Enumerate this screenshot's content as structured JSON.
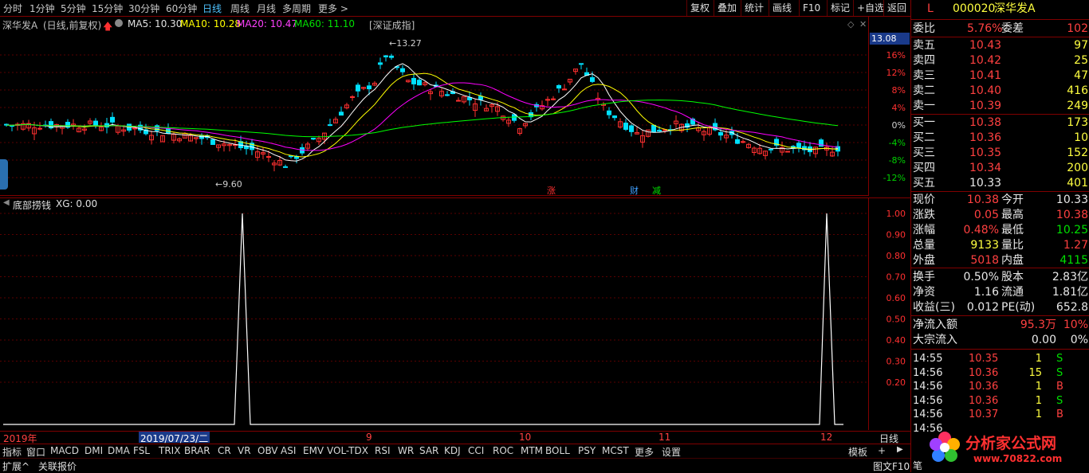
{
  "toolbar": {
    "periods": [
      "分时",
      "1分钟",
      "5分钟",
      "15分钟",
      "30分钟",
      "60分钟",
      "日线",
      "周线",
      "月线",
      "多周期",
      "更多 >"
    ],
    "active_period": "日线",
    "right_buttons": [
      "复权",
      "叠加",
      "统计",
      "画线",
      "F10",
      "标记",
      "+自选",
      "返回"
    ]
  },
  "chart_header": {
    "stock_name": "深华发A",
    "adjust": "(日线,前复权)",
    "ma5": "MA5: 10.30",
    "ma10": "MA10: 10.28",
    "ma20": "MA20: 10.47",
    "ma60": "MA60: 11.10",
    "index_tag": "[深证成指]",
    "high_label": "13.27",
    "low_label": "9.60",
    "price_tag": "13.08",
    "event_tags": [
      "涨",
      "财",
      "减"
    ]
  },
  "price_axis": [
    "16%",
    "12%",
    "8%",
    "4%",
    "0%",
    "-4%",
    "-8%",
    "-12%"
  ],
  "indicator": {
    "name": "底部捞钱",
    "value": "XG: 0.00",
    "axis": [
      "1.00",
      "0.90",
      "0.80",
      "0.70",
      "0.60",
      "0.50",
      "0.40",
      "0.30",
      "0.20"
    ]
  },
  "date_axis": {
    "year": "2019年",
    "cursor_date": "2019/07/23/二",
    "months": [
      "9",
      "10",
      "11",
      "12"
    ],
    "period_label": "日线"
  },
  "indicator_tabs": [
    "指标",
    "窗口",
    "MACD",
    "DMI",
    "DMA",
    "FSL",
    "TRIX",
    "BRAR",
    "CR",
    "VR",
    "OBV",
    "ASI",
    "EMV",
    "VOL-TDX",
    "RSI",
    "WR",
    "SAR",
    "KDJ",
    "CCI",
    "ROC",
    "MTM",
    "BOLL",
    "PSY",
    "MCST",
    "更多",
    "设置"
  ],
  "template_btn": "模板",
  "status": {
    "expand": "扩展^",
    "linked": "关联报价",
    "graphic": "图文F10",
    "note": "笔"
  },
  "quote": {
    "flag": "L",
    "code": "000020",
    "name": "深华发A",
    "weibi_label": "委比",
    "weibi": "5.76%",
    "weicha_label": "委差",
    "weicha": "102",
    "asks": [
      {
        "label": "卖五",
        "price": "10.43",
        "vol": "97"
      },
      {
        "label": "卖四",
        "price": "10.42",
        "vol": "25"
      },
      {
        "label": "卖三",
        "price": "10.41",
        "vol": "47"
      },
      {
        "label": "卖二",
        "price": "10.40",
        "vol": "416"
      },
      {
        "label": "卖一",
        "price": "10.39",
        "vol": "249"
      }
    ],
    "bids": [
      {
        "label": "买一",
        "price": "10.38",
        "vol": "173"
      },
      {
        "label": "买二",
        "price": "10.36",
        "vol": "10"
      },
      {
        "label": "买三",
        "price": "10.35",
        "vol": "152"
      },
      {
        "label": "买四",
        "price": "10.34",
        "vol": "200"
      },
      {
        "label": "买五",
        "price": "10.33",
        "vol": "401"
      }
    ],
    "stats": [
      {
        "l1": "现价",
        "v1": "10.38",
        "c1": "red",
        "l2": "今开",
        "v2": "10.33",
        "c2": "wht"
      },
      {
        "l1": "涨跌",
        "v1": "0.05",
        "c1": "red",
        "l2": "最高",
        "v2": "10.38",
        "c2": "red"
      },
      {
        "l1": "涨幅",
        "v1": "0.48%",
        "c1": "red",
        "l2": "最低",
        "v2": "10.25",
        "c2": "grn"
      },
      {
        "l1": "总量",
        "v1": "9133",
        "c1": "yel",
        "l2": "量比",
        "v2": "1.27",
        "c2": "red"
      },
      {
        "l1": "外盘",
        "v1": "5018",
        "c1": "red",
        "l2": "内盘",
        "v2": "4115",
        "c2": "grn"
      }
    ],
    "stats2": [
      {
        "l1": "换手",
        "v1": "0.50%",
        "l2": "股本",
        "v2": "2.83亿"
      },
      {
        "l1": "净资",
        "v1": "1.16",
        "l2": "流通",
        "v2": "1.81亿"
      },
      {
        "l1": "收益(三)",
        "v1": "0.012",
        "l2": "PE(动)",
        "v2": "652.8"
      }
    ],
    "flow": [
      {
        "label": "净流入额",
        "value": "95.3万",
        "pct": "10%"
      },
      {
        "label": "大宗流入",
        "value": "0.00",
        "pct": "0%"
      }
    ],
    "ticks": [
      {
        "time": "14:55",
        "price": "10.35",
        "vol": "1",
        "side": "S"
      },
      {
        "time": "14:56",
        "price": "10.36",
        "vol": "15",
        "side": "S"
      },
      {
        "time": "14:56",
        "price": "10.36",
        "vol": "1",
        "side": "B"
      },
      {
        "time": "14:56",
        "price": "10.36",
        "vol": "1",
        "side": "S"
      },
      {
        "time": "14:56",
        "price": "10.37",
        "vol": "1",
        "side": "B"
      },
      {
        "time": "14:56",
        "price": "",
        "vol": "",
        "side": ""
      }
    ],
    "watermark": "分析家公式网",
    "watermark_url": "www.70822.com"
  },
  "colors": {
    "up": "#ff3030",
    "down": "#00e0ff",
    "ma5": "#ffffff",
    "ma10": "#ffff00",
    "ma20": "#ff00ff",
    "ma60": "#00ff00",
    "grid": "#800000"
  }
}
